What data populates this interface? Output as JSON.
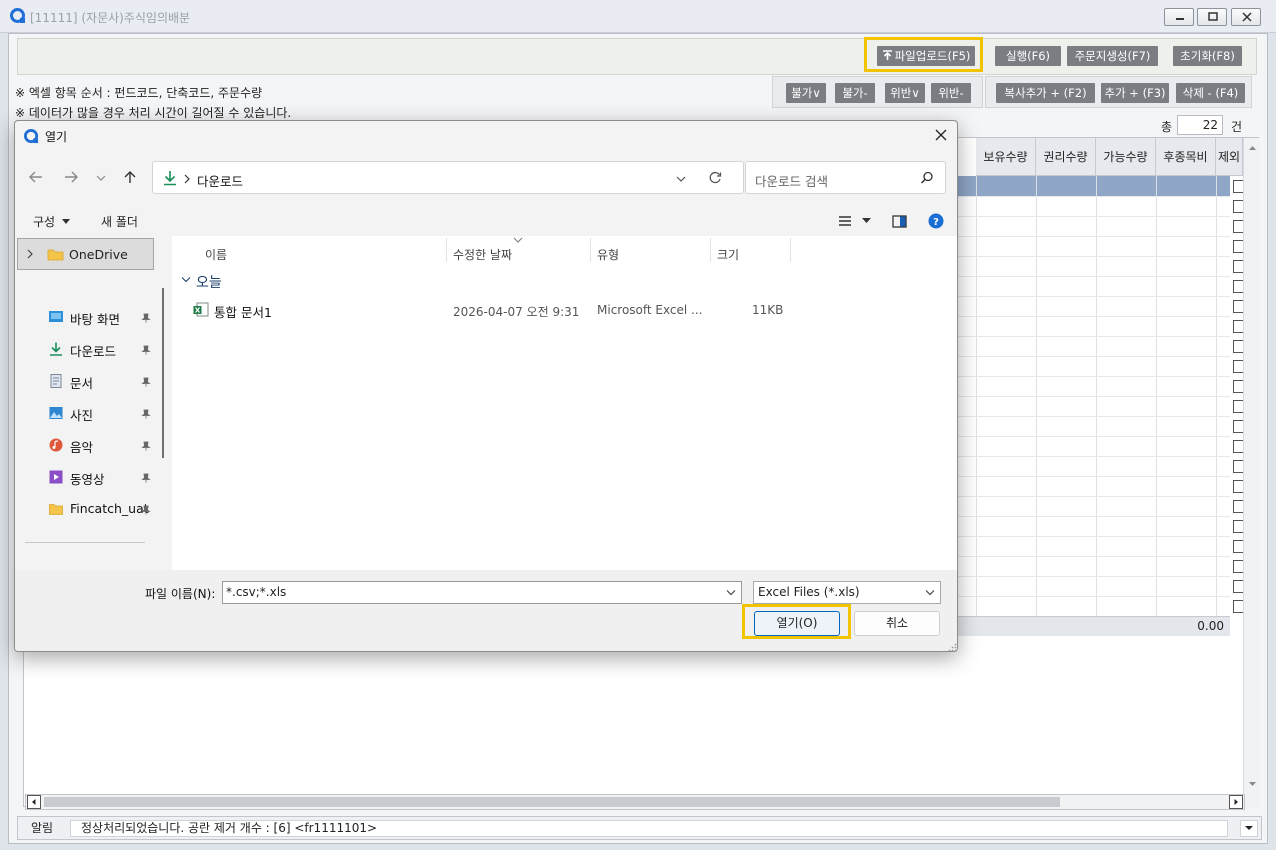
{
  "window": {
    "title": "[11111] (자문사)주식임의배분"
  },
  "toolbar": {
    "upload_label": "파일업로드(F5)",
    "run_label": "실행(F6)",
    "order_label": "주문지생성(F7)",
    "reset_label": "초기화(F8)"
  },
  "notes": {
    "line1": "※ 엑셀 항목 순서 : 펀드코드, 단축코드, 주문수량",
    "line2": "※ 데이터가 많을 경우 처리 시간이 길어질 수 있습니다."
  },
  "filter_buttons": [
    "불가∨",
    "불가-",
    "위반∨",
    "위반-"
  ],
  "edit_buttons": [
    "복사추가 + (F2)",
    "추가 + (F3)",
    "삭제 - (F4)"
  ],
  "total": {
    "label": "총",
    "count": "22",
    "unit": "건"
  },
  "grid": {
    "columns": [
      "보유수량",
      "권리수량",
      "가능수량",
      "후종목비",
      "제외"
    ],
    "sum_value": "0.00"
  },
  "status": {
    "label": "알림",
    "message": "정상처리되었습니다. 공란 제거 개수 : [6] <fr1111101>"
  },
  "dialog": {
    "title": "열기",
    "address_path": "다운로드",
    "search_placeholder": "다운로드 검색",
    "organize_label": "구성",
    "new_folder_label": "새 폴더",
    "nav_items": {
      "onedrive": "OneDrive",
      "desktop": "바탕 화면",
      "downloads": "다운로드",
      "documents": "문서",
      "pictures": "사진",
      "music": "음악",
      "videos": "동영상",
      "fincatch": "Fincatch_uat"
    },
    "columns": {
      "name": "이름",
      "modified": "수정한 날짜",
      "type": "유형",
      "size": "크기"
    },
    "group_label": "오늘",
    "file": {
      "name": "통합 문서1",
      "modified": "2026-04-07 오전 9:31",
      "type": "Microsoft Excel ...",
      "size": "11KB"
    },
    "filename_label": "파일 이름(N):",
    "filename_value": "*.csv;*.xls",
    "filter_value": "Excel Files (*.xls)",
    "open_label": "열기(O)",
    "cancel_label": "취소"
  },
  "colors": {
    "highlight": "#f2c400",
    "button_gray": "#7a7e83",
    "selected_row": "#8fa6c6",
    "accent_blue": "#0067c0"
  }
}
